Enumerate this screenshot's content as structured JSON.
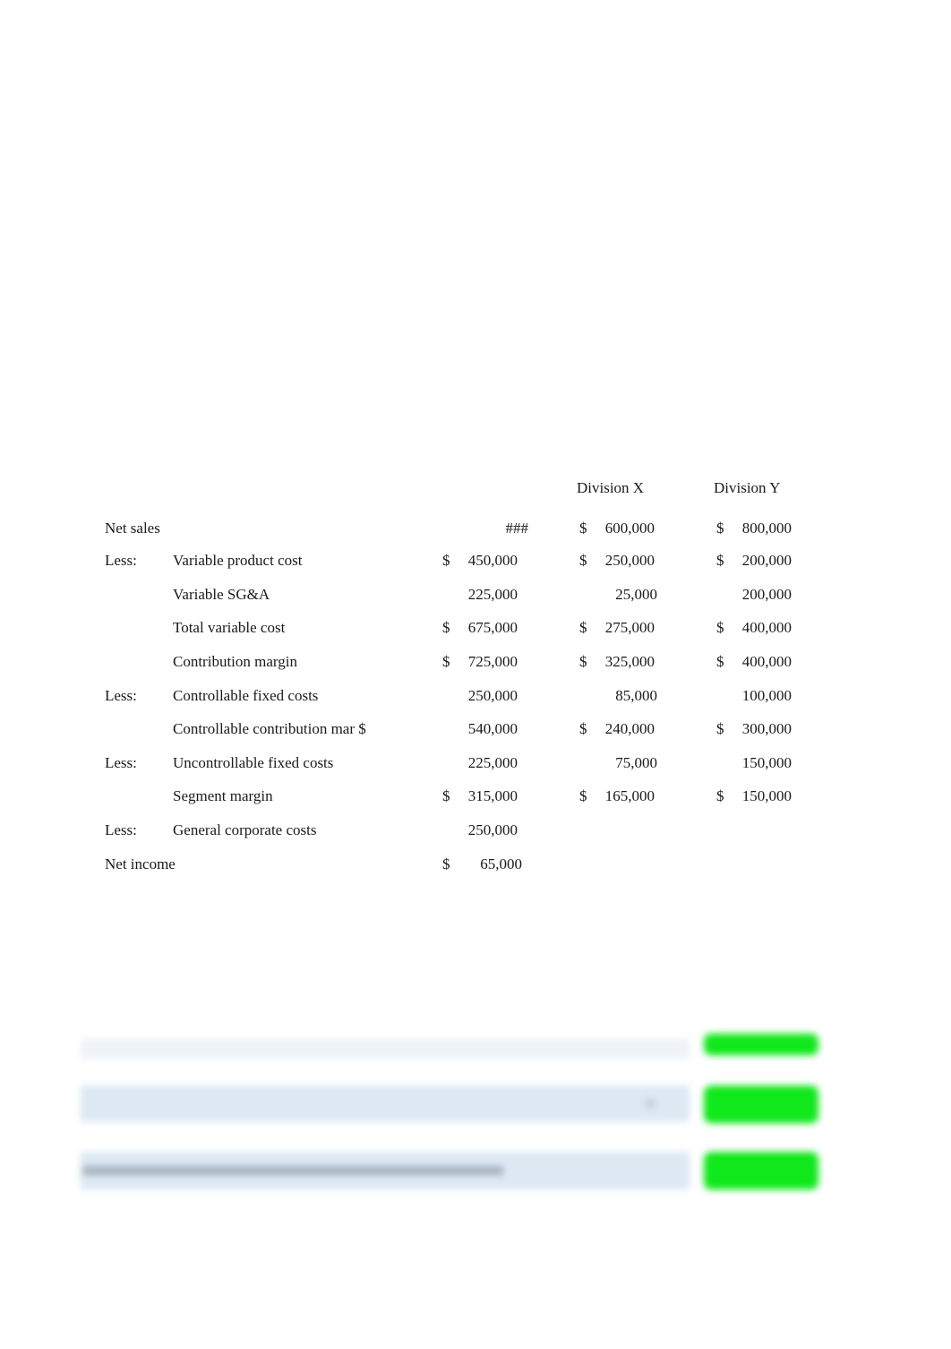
{
  "columns": {
    "division_x": "Division X",
    "division_y": "Division Y"
  },
  "rows": [
    {
      "prefix": "Net sales",
      "label": "",
      "total_dollar": "",
      "total": "###",
      "x_dollar": "$",
      "x": "600,000",
      "y_dollar": "$",
      "y": "800,000"
    },
    {
      "prefix": "Less:",
      "label": "Variable product cost",
      "total_dollar": "$",
      "total": "450,000",
      "x_dollar": "$",
      "x": "250,000",
      "y_dollar": "$",
      "y": "200,000"
    },
    {
      "prefix": "",
      "label": "Variable SG&A",
      "total_dollar": "",
      "total": "225,000",
      "x_dollar": "",
      "x": "25,000",
      "y_dollar": "",
      "y": "200,000"
    },
    {
      "prefix": "",
      "label": "Total variable cost",
      "total_dollar": "$",
      "total": "675,000",
      "x_dollar": "$",
      "x": "275,000",
      "y_dollar": "$",
      "y": "400,000"
    },
    {
      "prefix": "",
      "label": "Contribution margin",
      "total_dollar": "$",
      "total": "725,000",
      "x_dollar": "$",
      "x": "325,000",
      "y_dollar": "$",
      "y": "400,000"
    },
    {
      "prefix": "Less:",
      "label": "Controllable fixed costs",
      "total_dollar": "",
      "total": "250,000",
      "x_dollar": "",
      "x": "85,000",
      "y_dollar": "",
      "y": "100,000"
    },
    {
      "prefix": "",
      "label": "Controllable contribution mar $",
      "total_dollar": "",
      "total": "540,000",
      "x_dollar": "$",
      "x": "240,000",
      "y_dollar": "$",
      "y": "300,000"
    },
    {
      "prefix": "Less:",
      "label": "Uncontrollable fixed costs",
      "total_dollar": "",
      "total": "225,000",
      "x_dollar": "",
      "x": "75,000",
      "y_dollar": "",
      "y": "150,000"
    },
    {
      "prefix": "",
      "label": "Segment margin",
      "total_dollar": "$",
      "total": "315,000",
      "x_dollar": "$",
      "x": "165,000",
      "y_dollar": "$",
      "y": "150,000"
    },
    {
      "prefix": "Less:",
      "label": "General corporate costs",
      "total_dollar": "",
      "total": "250,000",
      "x_dollar": "",
      "x": "",
      "y_dollar": "",
      "y": ""
    },
    {
      "prefix": "Net income",
      "label": "",
      "total_dollar": "$",
      "total": "65,000",
      "x_dollar": "",
      "x": "",
      "y_dollar": "",
      "y": ""
    }
  ],
  "obscured_section": {
    "bar_color": "#dde8f3",
    "button_color": "#0fe81a"
  }
}
